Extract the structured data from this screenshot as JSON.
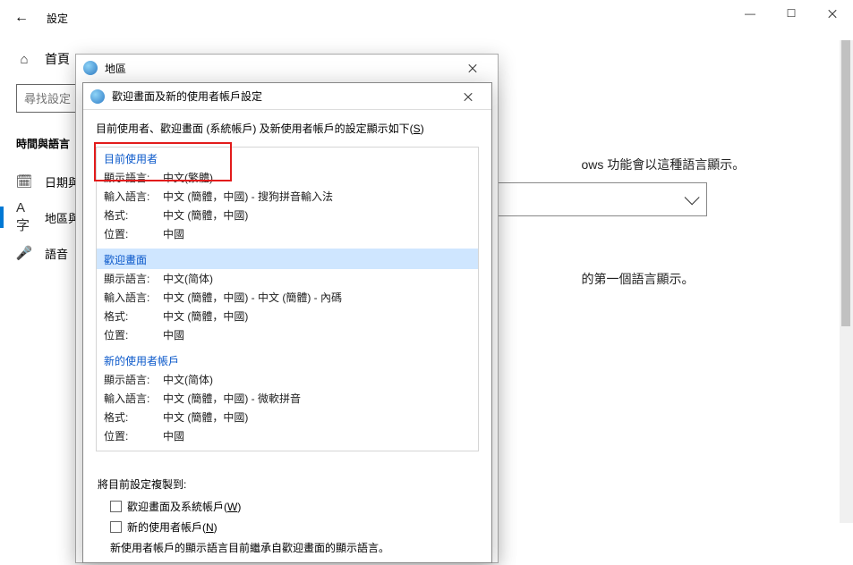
{
  "settings": {
    "back_aria": "Back",
    "title": "設定",
    "win": {
      "min": "—",
      "max": "☐",
      "close": "✕"
    },
    "home": "首頁",
    "search_placeholder": "尋找設定",
    "section": "時間與語言",
    "nav": [
      {
        "icon": "🗓",
        "label": "日期與時間"
      },
      {
        "icon": "A字",
        "label": "地區與語言"
      },
      {
        "icon": "🎤",
        "label": "語音"
      }
    ],
    "main": {
      "line1_suffix": "ows 功能會以這種語言顯示。",
      "line2_suffix": "的第一個語言顯示。"
    }
  },
  "region_dialog": {
    "title": "地區"
  },
  "welcome_dialog": {
    "title": "歡迎畫面及新的使用者帳戶設定",
    "intro": "目前使用者、歡迎畫面 (系統帳戶) 及新使用者帳戶的設定顯示如下(",
    "intro_hotkey": "S",
    "intro_suffix": ")",
    "sections": [
      {
        "header": "目前使用者",
        "selected": false,
        "rows": [
          {
            "label": "顯示語言:",
            "value": "中文(繁體)"
          },
          {
            "label": "輸入語言:",
            "value": "中文 (簡體，中國) - 搜狗拼音輸入法"
          },
          {
            "label": "格式:",
            "value": "中文 (簡體，中國)"
          },
          {
            "label": "位置:",
            "value": "中國"
          }
        ]
      },
      {
        "header": "歡迎畫面",
        "selected": true,
        "rows": [
          {
            "label": "顯示語言:",
            "value": "中文(简体)"
          },
          {
            "label": "輸入語言:",
            "value": "中文 (簡體，中國) - 中文 (簡體) - 內碼"
          },
          {
            "label": "格式:",
            "value": "中文 (簡體，中國)"
          },
          {
            "label": "位置:",
            "value": "中國"
          }
        ]
      },
      {
        "header": "新的使用者帳戶",
        "selected": false,
        "rows": [
          {
            "label": "顯示語言:",
            "value": "中文(简体)"
          },
          {
            "label": "輸入語言:",
            "value": "中文 (簡體，中國) - 微軟拼音"
          },
          {
            "label": "格式:",
            "value": "中文 (簡體，中國)"
          },
          {
            "label": "位置:",
            "value": "中國"
          }
        ]
      }
    ],
    "copy_label": "將目前設定複製到:",
    "checkboxes": [
      {
        "label": "歡迎畫面及系統帳戶(",
        "hotkey": "W",
        "suffix": ")"
      },
      {
        "label": "新的使用者帳戶(",
        "hotkey": "N",
        "suffix": ")"
      }
    ],
    "note": "新使用者帳戶的顯示語言目前繼承自歡迎畫面的顯示語言。"
  }
}
